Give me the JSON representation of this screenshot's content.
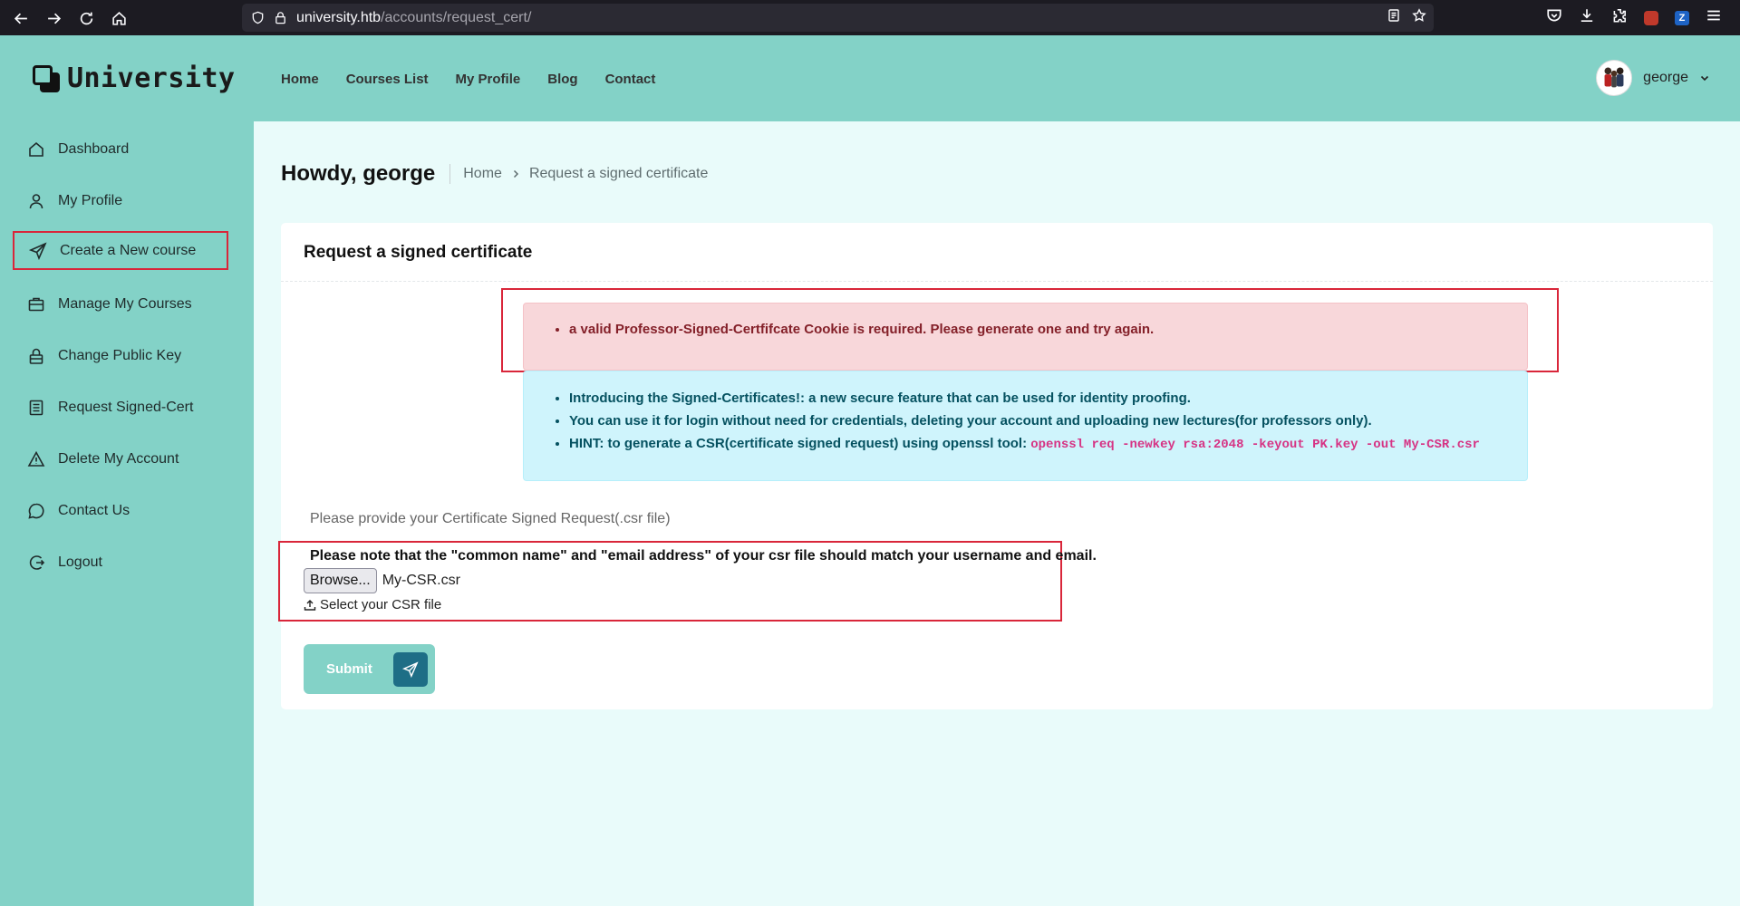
{
  "browser": {
    "url_host": "university.htb",
    "url_path": "/accounts/request_cert/"
  },
  "header": {
    "brand": "University",
    "nav": [
      "Home",
      "Courses List",
      "My Profile",
      "Blog",
      "Contact"
    ],
    "username": "george"
  },
  "sidebar": {
    "items": [
      {
        "label": "Dashboard",
        "icon": "home-icon"
      },
      {
        "label": "My Profile",
        "icon": "user-icon"
      },
      {
        "label": "Create a New course",
        "icon": "send-icon"
      },
      {
        "label": "Manage My Courses",
        "icon": "briefcase-icon"
      },
      {
        "label": "Change Public Key",
        "icon": "lock-icon"
      },
      {
        "label": "Request Signed-Cert",
        "icon": "document-icon"
      },
      {
        "label": "Delete My Account",
        "icon": "warning-icon"
      },
      {
        "label": "Contact Us",
        "icon": "chat-icon"
      },
      {
        "label": "Logout",
        "icon": "logout-icon"
      }
    ]
  },
  "page": {
    "greeting": "Howdy, george",
    "breadcrumb": [
      "Home",
      "Request a signed certificate"
    ]
  },
  "card": {
    "title": "Request a signed certificate",
    "error": "a valid Professor-Signed-Certfifcate Cookie is required. Please generate one and try again.",
    "info": [
      "Introducing the Signed-Certificates!: a new secure feature that can be used for identity proofing.",
      "You can use it for login without need for credentials, deleting your account and uploading new lectures(for professors only)."
    ],
    "hint_prefix": "HINT: to generate a CSR(certificate signed request) using openssl tool:",
    "hint_cmd": "openssl req -newkey rsa:2048 -keyout PK.key -out My-CSR.csr",
    "csr_label": "Please provide your Certificate Signed Request(.csr file)",
    "note": "Please note that the \"common name\" and \"email address\" of your csr file should match your username and email.",
    "browse_label": "Browse...",
    "file_name": "My-CSR.csr",
    "file_help": "Select your CSR file",
    "submit_label": "Submit"
  },
  "colors": {
    "theme": "#83d2c7",
    "danger_bg": "#f8d7da",
    "info_bg": "#cff4fc",
    "highlight_border": "#d9263a"
  }
}
